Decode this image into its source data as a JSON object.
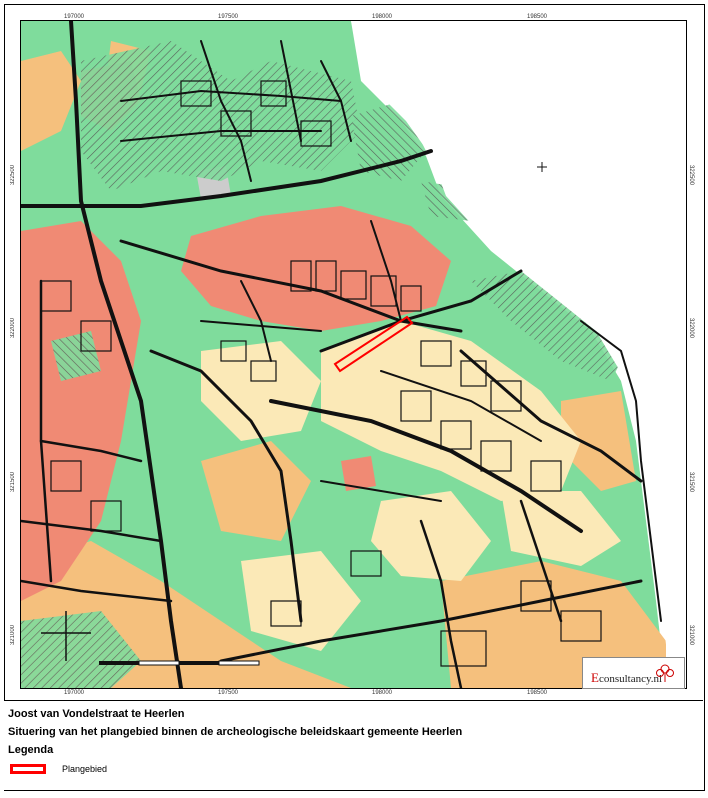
{
  "map": {
    "coords_top": [
      "197000",
      "197500",
      "198000",
      "198500"
    ],
    "coords_bottom": [
      "197000",
      "197500",
      "198000",
      "198500"
    ],
    "coords_left": [
      "322500",
      "322000",
      "321500",
      "321000"
    ],
    "coords_right": [
      "322500",
      "322000",
      "321500",
      "321000"
    ],
    "colors": {
      "high_value": "#f08a74",
      "medium_value": "#f5c07d",
      "low_value": "#fbe9b7",
      "disturbed": "#7fdc9c",
      "grey": "#cccccc",
      "line": "#111111",
      "plangebied": "#ff0000"
    }
  },
  "logo": {
    "text_first": "E",
    "text_rest": "consultancy.nl"
  },
  "legend": {
    "title": "Joost van Vondelstraat te Heerlen",
    "subtitle": "Situering van het plangebied binnen de archeologische beleidskaart gemeente Heerlen",
    "heading": "Legenda",
    "items": [
      {
        "label": "Plangebied",
        "color": "#ff0000"
      }
    ]
  }
}
